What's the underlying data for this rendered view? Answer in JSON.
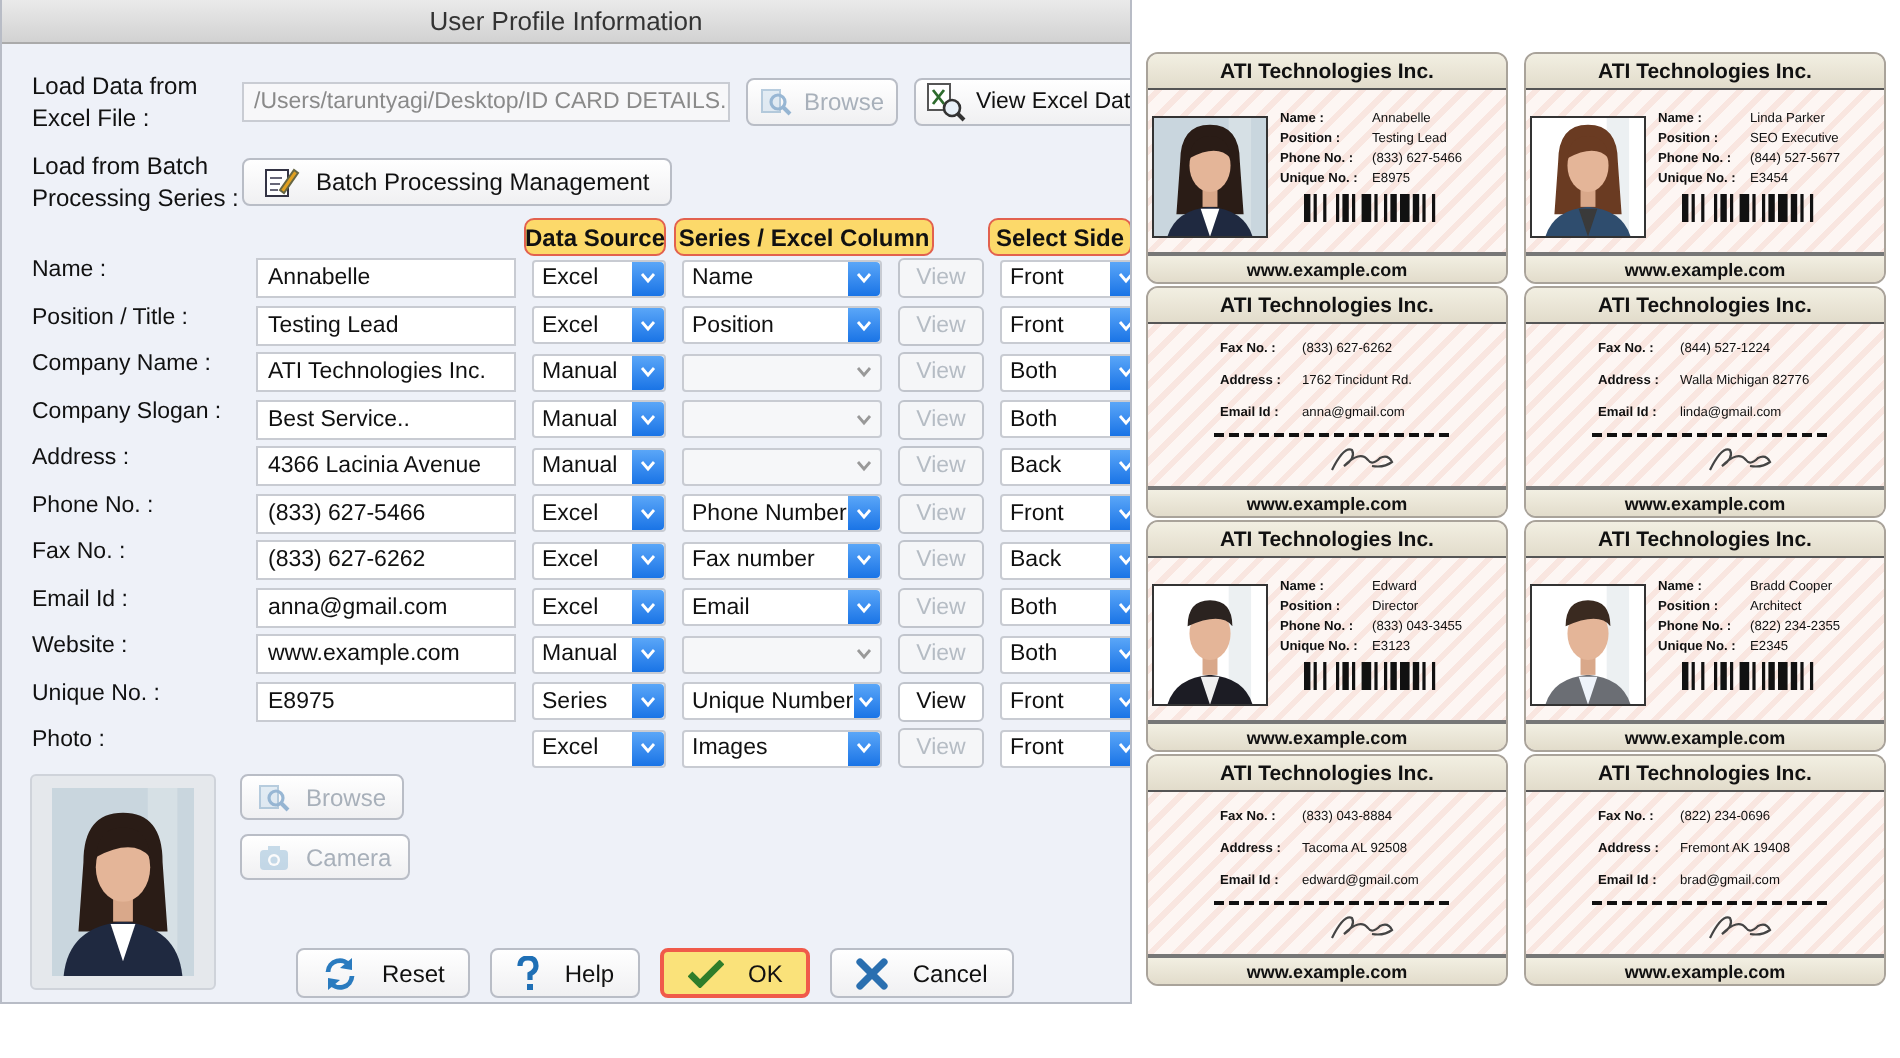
{
  "window": {
    "title": "User Profile Information"
  },
  "load_excel": {
    "label": "Load Data from Excel File :",
    "path": "/Users/taruntyagi/Desktop/ID CARD DETAILS.",
    "browse_button": {
      "label": "Browse",
      "disabled": true
    },
    "view_button": {
      "label": "View Excel Dat",
      "disabled": false
    }
  },
  "batch": {
    "label": "Load from Batch Processing Series :",
    "button": "Batch Processing Management"
  },
  "column_headers": [
    "Data Source",
    "Series / Excel Column",
    "Select Side"
  ],
  "fields": [
    {
      "label": "Name :",
      "value": "Annabelle",
      "source": "Excel",
      "column": {
        "value": "Name",
        "disabled": false
      },
      "view": {
        "label": "View",
        "disabled": true
      },
      "side": "Front"
    },
    {
      "label": "Position / Title :",
      "value": "Testing Lead",
      "source": "Excel",
      "column": {
        "value": "Position",
        "disabled": false
      },
      "view": {
        "label": "View",
        "disabled": true
      },
      "side": "Front"
    },
    {
      "label": "Company Name :",
      "value": "ATI Technologies Inc.",
      "source": "Manual",
      "column": {
        "disabled": true
      },
      "view": {
        "label": "View",
        "disabled": true
      },
      "side": "Both"
    },
    {
      "label": "Company Slogan :",
      "value": "Best Service..",
      "source": "Manual",
      "column": {
        "disabled": true
      },
      "view": {
        "label": "View",
        "disabled": true
      },
      "side": "Both"
    },
    {
      "label": "Address :",
      "value": "4366 Lacinia Avenue",
      "source": "Manual",
      "column": {
        "disabled": true
      },
      "view": {
        "label": "View",
        "disabled": true
      },
      "side": "Back"
    },
    {
      "label": "Phone No. :",
      "value": "(833) 627-5466",
      "source": "Excel",
      "column": {
        "value": "Phone Number",
        "disabled": false
      },
      "view": {
        "label": "View",
        "disabled": true
      },
      "side": "Front"
    },
    {
      "label": "Fax No. :",
      "value": "(833) 627-6262",
      "source": "Excel",
      "column": {
        "value": "Fax number",
        "disabled": false
      },
      "view": {
        "label": "View",
        "disabled": true
      },
      "side": "Back"
    },
    {
      "label": "Email Id :",
      "value": "anna@gmail.com",
      "source": "Excel",
      "column": {
        "value": "Email",
        "disabled": false
      },
      "view": {
        "label": "View",
        "disabled": true
      },
      "side": "Both"
    },
    {
      "label": "Website :",
      "value": "www.example.com",
      "source": "Manual",
      "column": {
        "disabled": true
      },
      "view": {
        "label": "View",
        "disabled": true
      },
      "side": "Both"
    },
    {
      "label": "Unique No. :",
      "value": "E8975",
      "source": "Series",
      "column": {
        "value": "Unique Number",
        "disabled": false
      },
      "view": {
        "label": "View",
        "disabled": false
      },
      "side": "Front"
    }
  ],
  "photo": {
    "label": "Photo :",
    "source": "Excel",
    "column": {
      "value": "Images",
      "disabled": false
    },
    "view": {
      "label": "View",
      "disabled": true
    },
    "side": "Front",
    "browse_button": {
      "label": "Browse",
      "disabled": true
    },
    "camera_button": {
      "label": "Camera",
      "disabled": true
    }
  },
  "buttons": [
    {
      "kind": "reset",
      "label": "Reset",
      "default": false
    },
    {
      "kind": "help",
      "label": "Help",
      "default": false
    },
    {
      "kind": "ok",
      "label": "OK",
      "default": true
    },
    {
      "kind": "cancel",
      "label": "Cancel",
      "default": false
    }
  ],
  "cards": [
    {
      "kind": "front",
      "company": "ATI Technologies Inc.",
      "rows": [
        {
          "label": "Name :",
          "value": "Annabelle"
        },
        {
          "label": "Position :",
          "value": "Testing Lead"
        },
        {
          "label": "Phone No. :",
          "value": "(833) 627-5466"
        },
        {
          "label": "Unique No. :",
          "value": "E8975"
        }
      ],
      "website": "www.example.com"
    },
    {
      "kind": "front",
      "company": "ATI Technologies Inc.",
      "rows": [
        {
          "label": "Name :",
          "value": "Linda Parker"
        },
        {
          "label": "Position :",
          "value": "SEO Executive"
        },
        {
          "label": "Phone No. :",
          "value": "(844) 527-5677"
        },
        {
          "label": "Unique No. :",
          "value": "E3454"
        }
      ],
      "website": "www.example.com"
    },
    {
      "kind": "back",
      "company": "ATI Technologies Inc.",
      "rows": [
        {
          "label": "Fax No. :",
          "value": "(833) 627-6262"
        },
        {
          "label": "Address :",
          "value": "1762 Tincidunt Rd."
        },
        {
          "label": "Email Id :",
          "value": "anna@gmail.com"
        }
      ],
      "website": "www.example.com"
    },
    {
      "kind": "back",
      "company": "ATI Technologies Inc.",
      "rows": [
        {
          "label": "Fax No. :",
          "value": "(844) 527-1224"
        },
        {
          "label": "Address :",
          "value": "Walla Michigan 82776"
        },
        {
          "label": "Email Id :",
          "value": "linda@gmail.com"
        }
      ],
      "website": "www.example.com"
    },
    {
      "kind": "front",
      "company": "ATI Technologies Inc.",
      "rows": [
        {
          "label": "Name :",
          "value": "Edward"
        },
        {
          "label": "Position :",
          "value": "Director"
        },
        {
          "label": "Phone No. :",
          "value": "(833) 043-3455"
        },
        {
          "label": "Unique No. :",
          "value": "E3123"
        }
      ],
      "website": "www.example.com"
    },
    {
      "kind": "front",
      "company": "ATI Technologies Inc.",
      "rows": [
        {
          "label": "Name :",
          "value": "Bradd Cooper"
        },
        {
          "label": "Position :",
          "value": "Architect"
        },
        {
          "label": "Phone No. :",
          "value": "(822) 234-2355"
        },
        {
          "label": "Unique No. :",
          "value": "E2345"
        }
      ],
      "website": "www.example.com"
    },
    {
      "kind": "back",
      "company": "ATI Technologies Inc.",
      "rows": [
        {
          "label": "Fax No. :",
          "value": "(833) 043-8884"
        },
        {
          "label": "Address :",
          "value": "Tacoma AL 92508"
        },
        {
          "label": "Email Id :",
          "value": "edward@gmail.com"
        }
      ],
      "website": "www.example.com"
    },
    {
      "kind": "back",
      "company": "ATI Technologies Inc.",
      "rows": [
        {
          "label": "Fax No. :",
          "value": "(822) 234-0696"
        },
        {
          "label": "Address :",
          "value": "Fremont AK 19408"
        },
        {
          "label": "Email Id :",
          "value": "brad@gmail.com"
        }
      ],
      "website": "www.example.com"
    }
  ]
}
